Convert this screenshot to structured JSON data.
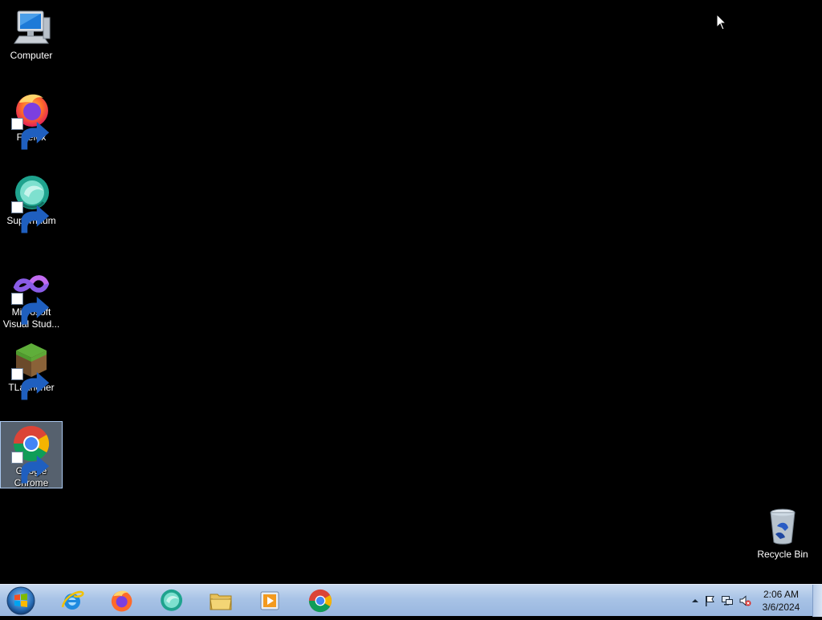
{
  "desktop": {
    "background_color": "#000000",
    "icons": [
      {
        "label": "Computer",
        "icon": "computer-icon",
        "shortcut": false
      },
      {
        "label": "Firefox",
        "icon": "firefox-icon",
        "shortcut": true
      },
      {
        "label": "Supermium",
        "icon": "supermium-icon",
        "shortcut": true
      },
      {
        "label": "Microsoft Visual Stud...",
        "icon": "visual-studio-icon",
        "shortcut": true
      },
      {
        "label": "TLauncher",
        "icon": "tlauncher-icon",
        "shortcut": true
      },
      {
        "label": "Google Chrome",
        "icon": "chrome-icon",
        "shortcut": true,
        "selected": true
      }
    ],
    "recycle_bin": {
      "label": "Recycle Bin",
      "icon": "recycle-bin-icon"
    }
  },
  "taskbar": {
    "start": {
      "icon": "windows-start-icon"
    },
    "pinned": [
      {
        "icon": "internet-explorer-icon"
      },
      {
        "icon": "firefox-icon"
      },
      {
        "icon": "supermium-icon"
      },
      {
        "icon": "file-explorer-icon"
      },
      {
        "icon": "media-player-icon"
      },
      {
        "icon": "chrome-icon"
      }
    ],
    "tray": {
      "icons": [
        "show-hidden-icons-icon",
        "action-center-flag-icon",
        "network-icon",
        "volume-muted-icon"
      ],
      "time": "2:06 AM",
      "date": "3/6/2024"
    }
  }
}
